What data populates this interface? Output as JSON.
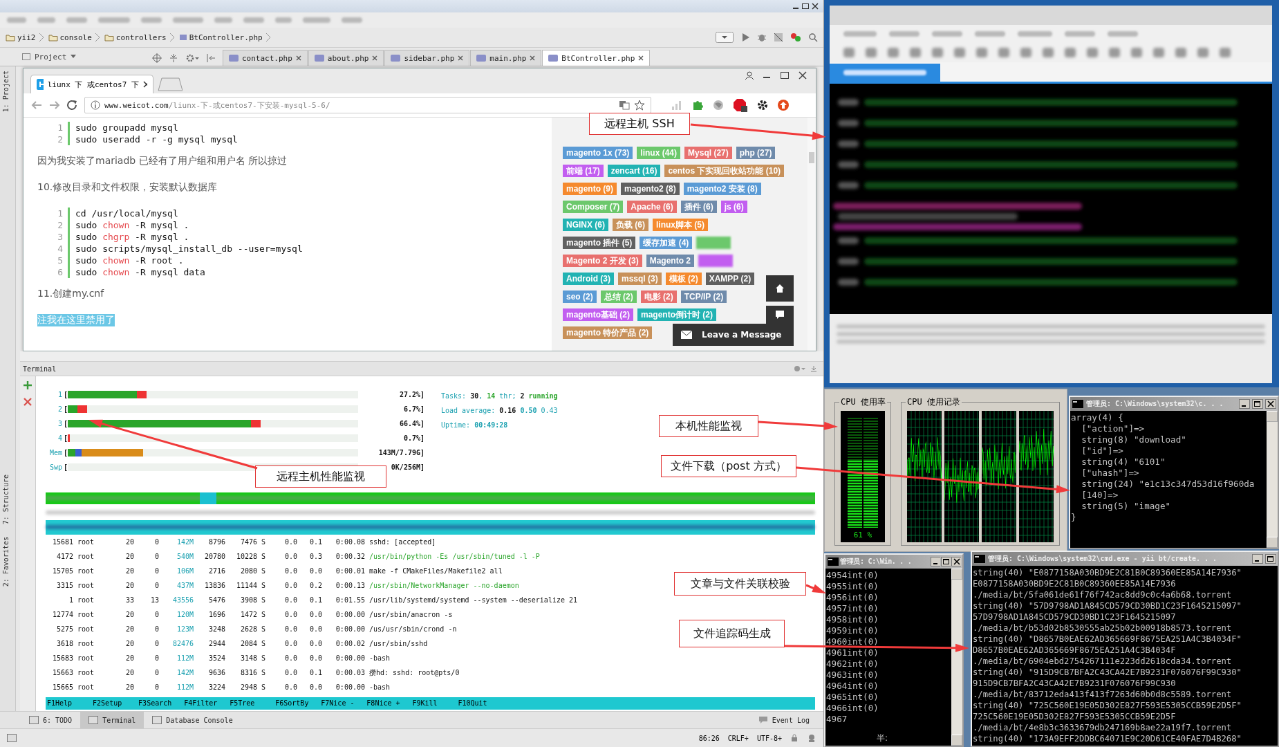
{
  "ide": {
    "breadcrumb": [
      "yii2",
      "console",
      "controllers",
      "BtController.php"
    ],
    "project_tab": "Project",
    "editor_tabs": [
      {
        "label": "contact.php",
        "selected": false
      },
      {
        "label": "about.php",
        "selected": false
      },
      {
        "label": "sidebar.php",
        "selected": false
      },
      {
        "label": "main.php",
        "selected": false
      },
      {
        "label": "BtController.php",
        "selected": true
      }
    ],
    "side_tools": [
      "1: Project",
      "7: Structure",
      "2: Favorites"
    ],
    "browser": {
      "tab_title": "liunx 下 或centos7 下",
      "url_host": "www.weicot.com",
      "url_path": "/liunx-下-或centos7-下安装-mysql-5-6/",
      "content": [
        {
          "kind": "code",
          "lines": [
            {
              "no": "1",
              "parts": [
                {
                  "t": "sudo groupadd mysql",
                  "kind": "plain"
                }
              ]
            },
            {
              "no": "2",
              "parts": [
                {
                  "t": "sudo useradd -r -g mysql mysql",
                  "kind": "plain"
                }
              ]
            }
          ]
        },
        {
          "kind": "para",
          "text": "因为我安装了mariadb 已经有了用户组和用户名 所以掠过",
          "highlighted": false
        },
        {
          "kind": "para",
          "text": "10.修改目录和文件权限，安装默认数据库",
          "highlighted": false
        },
        {
          "kind": "code",
          "lines": [
            {
              "no": "1",
              "parts": [
                {
                  "t": "cd /usr/local/mysql",
                  "kind": "plain"
                }
              ]
            },
            {
              "no": "2",
              "parts": [
                {
                  "t": "sudo ",
                  "kind": "plain"
                },
                {
                  "t": "chown",
                  "kind": "keyword"
                },
                {
                  "t": " -R mysql .",
                  "kind": "plain"
                }
              ]
            },
            {
              "no": "3",
              "parts": [
                {
                  "t": "sudo ",
                  "kind": "plain"
                },
                {
                  "t": "chgrp",
                  "kind": "keyword"
                },
                {
                  "t": " -R mysql .",
                  "kind": "plain"
                }
              ]
            },
            {
              "no": "4",
              "parts": [
                {
                  "t": "sudo scripts/mysql_install_db --user=mysql",
                  "kind": "plain"
                }
              ]
            },
            {
              "no": "5",
              "parts": [
                {
                  "t": "sudo ",
                  "kind": "plain"
                },
                {
                  "t": "chown",
                  "kind": "keyword"
                },
                {
                  "t": " -R root .",
                  "kind": "plain"
                }
              ]
            },
            {
              "no": "6",
              "parts": [
                {
                  "t": "sudo ",
                  "kind": "plain"
                },
                {
                  "t": "chown",
                  "kind": "keyword"
                },
                {
                  "t": " -R mysql data",
                  "kind": "plain"
                }
              ]
            }
          ]
        },
        {
          "kind": "para",
          "text": "11.创建my.cnf",
          "highlighted": false
        },
        {
          "kind": "para",
          "text": "注我在这里禁用了",
          "highlighted": true
        }
      ],
      "tag_rows": [
        [
          {
            "kind": "tag",
            "label": "magento 1x (73)",
            "color": "#5b9bd5"
          },
          {
            "kind": "tag",
            "label": "linux (44)",
            "color": "#6cc86c"
          },
          {
            "kind": "tag",
            "label": "Mysql (27)",
            "color": "#e8706e"
          },
          {
            "kind": "tag",
            "label": "php (27)",
            "color": "#6f8bab"
          }
        ],
        [
          {
            "kind": "tag",
            "label": "前端 (17)",
            "color": "#c25ef0"
          },
          {
            "kind": "tag",
            "label": "zencart (16)",
            "color": "#22b3b3"
          },
          {
            "kind": "tag",
            "label": "centos 下实现回收站功能 (10)",
            "color": "#c8915a"
          }
        ],
        [
          {
            "kind": "tag",
            "label": "magento (9)",
            "color": "#f58a2e"
          },
          {
            "kind": "tag",
            "label": "magento2 (8)",
            "color": "#606060"
          },
          {
            "kind": "tag",
            "label": "magento2 安装 (8)",
            "color": "#5b9bd5"
          }
        ],
        [
          {
            "kind": "tag",
            "label": "Composer (7)",
            "color": "#6cc86c"
          },
          {
            "kind": "tag",
            "label": "Apache (6)",
            "color": "#e8706e"
          },
          {
            "kind": "tag",
            "label": "插件 (6)",
            "color": "#6f8bab"
          },
          {
            "kind": "tag",
            "label": "js (6)",
            "color": "#c25ef0"
          }
        ],
        [
          {
            "kind": "tag",
            "label": "NGINX (6)",
            "color": "#22b3b3"
          },
          {
            "kind": "tag",
            "label": "负载 (6)",
            "color": "#c8915a"
          },
          {
            "kind": "tag",
            "label": "linux脚本 (5)",
            "color": "#f58a2e"
          }
        ],
        [
          {
            "kind": "tag",
            "label": "magento 插件 (5)",
            "color": "#606060"
          },
          {
            "kind": "tag",
            "label": "缓存加速 (4)",
            "color": "#5b9bd5"
          },
          {
            "kind": "blurred",
            "color": "#6cc86c"
          }
        ],
        [
          {
            "kind": "tag",
            "label": "Magento 2 开发 (3)",
            "color": "#e8706e"
          },
          {
            "kind": "tag",
            "label": "Magento 2",
            "color": "#6f8bab"
          },
          {
            "kind": "blurred",
            "color": "#c25ef0"
          }
        ],
        [
          {
            "kind": "tag",
            "label": "Android (3)",
            "color": "#22b3b3"
          },
          {
            "kind": "tag",
            "label": "mssql (3)",
            "color": "#c8915a"
          },
          {
            "kind": "tag",
            "label": "模板 (2)",
            "color": "#f58a2e"
          },
          {
            "kind": "tag",
            "label": "XAMPP (2)",
            "color": "#606060"
          }
        ],
        [
          {
            "kind": "tag",
            "label": "seo (2)",
            "color": "#5b9bd5"
          },
          {
            "kind": "tag",
            "label": "总结 (2)",
            "color": "#6cc86c"
          },
          {
            "kind": "tag",
            "label": "电影 (2)",
            "color": "#e8706e"
          },
          {
            "kind": "tag",
            "label": "TCP/IP (2)",
            "color": "#6f8bab"
          }
        ],
        [
          {
            "kind": "tag",
            "label": "magento基础 (2)",
            "color": "#c25ef0"
          },
          {
            "kind": "tag",
            "label": "magento倒计时 (2)",
            "color": "#22b3b3"
          }
        ],
        [
          {
            "kind": "tag",
            "label": "magento 特价产品 (2)",
            "color": "#c8915a"
          }
        ]
      ],
      "leave_message": "Leave a Message"
    },
    "terminal": {
      "title": "Terminal",
      "meters": [
        {
          "label": "1",
          "kind": "cpu",
          "bracket": "[",
          "level": 0.272,
          "reading": "27.2%]"
        },
        {
          "label": "2",
          "kind": "cpu",
          "bracket": "[",
          "level": 0.067,
          "reading": "6.7%]"
        },
        {
          "label": "3",
          "kind": "cpu",
          "bracket": "[",
          "level": 0.664,
          "reading": "66.4%]"
        },
        {
          "label": "4",
          "kind": "cpu",
          "bracket": "[",
          "level": 0.007,
          "reading": "0.7%]"
        },
        {
          "label": "Mem",
          "kind": "mem",
          "bracket": "[",
          "level": 0.26,
          "reading": "143M/7.79G]"
        },
        {
          "label": "Swp",
          "bracket": "[",
          "reading": "0K/256M]"
        }
      ],
      "summary": [
        [
          {
            "t": "Tasks: ",
            "kind": "label"
          },
          {
            "t": "30",
            "kind": "value"
          },
          {
            "t": ", ",
            "kind": "label"
          },
          {
            "t": "14",
            "kind": "accent"
          },
          {
            "t": " thr; ",
            "kind": "label"
          },
          {
            "t": "2",
            "kind": "value"
          },
          {
            "t": " running",
            "kind": "accent"
          }
        ],
        [
          {
            "t": "Load average: ",
            "kind": "label"
          },
          {
            "t": "0.16",
            "kind": "value"
          },
          {
            "t": " 0.50",
            "kind": "strong"
          },
          {
            "t": " 0.43",
            "kind": "label"
          }
        ],
        [
          {
            "t": "Uptime: ",
            "kind": "label"
          },
          {
            "t": "00:49:28",
            "kind": "strong"
          }
        ]
      ],
      "processes": [
        {
          "kind": "blurred"
        },
        {
          "kind": "blurred_selected"
        },
        {
          "kind": "row",
          "pid": "15681",
          "user": "root",
          "pri": "20",
          "ni": "0",
          "virt": "142M",
          "res": "8796",
          "shr": "7476",
          "s": "S",
          "cpu": "0.0",
          "mem": "0.1",
          "time": "0:00.08",
          "command": "sshd: [accepted]",
          "highlight": false
        },
        {
          "kind": "row",
          "pid": "4172",
          "user": "root",
          "pri": "20",
          "ni": "0",
          "virt": "540M",
          "res": "20780",
          "shr": "10228",
          "s": "S",
          "cpu": "0.0",
          "mem": "0.3",
          "time": "0:00.32",
          "command": "/usr/bin/python -Es /usr/sbin/tuned -l -P",
          "highlight": true
        },
        {
          "kind": "row",
          "pid": "15705",
          "user": "root",
          "pri": "20",
          "ni": "0",
          "virt": "106M",
          "res": "2716",
          "shr": "2080",
          "s": "S",
          "cpu": "0.0",
          "mem": "0.0",
          "time": "0:00.01",
          "command": "make -f CMakeFiles/Makefile2 all",
          "highlight": false
        },
        {
          "kind": "row",
          "pid": "3315",
          "user": "root",
          "pri": "20",
          "ni": "0",
          "virt": "437M",
          "res": "13836",
          "shr": "11144",
          "s": "S",
          "cpu": "0.0",
          "mem": "0.2",
          "time": "0:00.13",
          "command": "/usr/sbin/NetworkManager --no-daemon",
          "highlight": true
        },
        {
          "kind": "row",
          "pid": "1",
          "user": "root",
          "pri": "33",
          "ni": "13",
          "virt": "43556",
          "res": "5476",
          "shr": "3908",
          "s": "S",
          "cpu": "0.0",
          "mem": "0.1",
          "time": "0:01.55",
          "command": "/usr/lib/systemd/systemd --system --deserialize 21",
          "highlight": false
        },
        {
          "kind": "row",
          "pid": "12774",
          "user": "root",
          "pri": "20",
          "ni": "0",
          "virt": "120M",
          "res": "1696",
          "shr": "1472",
          "s": "S",
          "cpu": "0.0",
          "mem": "0.0",
          "time": "0:00.00",
          "command": "/usr/sbin/anacron -s",
          "highlight": false
        },
        {
          "kind": "row",
          "pid": "5275",
          "user": "root",
          "pri": "20",
          "ni": "0",
          "virt": "123M",
          "res": "3248",
          "shr": "2628",
          "s": "S",
          "cpu": "0.0",
          "mem": "0.0",
          "time": "0:00.00",
          "command": "/us/usr/sbin/crond -n",
          "highlight": false
        },
        {
          "kind": "row",
          "pid": "3618",
          "user": "root",
          "pri": "20",
          "ni": "0",
          "virt": "82476",
          "res": "2944",
          "shr": "2084",
          "s": "S",
          "cpu": "0.0",
          "mem": "0.0",
          "time": "0:00.02",
          "command": "/usr/sbin/sshd",
          "highlight": false
        },
        {
          "kind": "row",
          "pid": "15683",
          "user": "root",
          "pri": "20",
          "ni": "0",
          "virt": "112M",
          "res": "3524",
          "shr": "3148",
          "s": "S",
          "cpu": "0.0",
          "mem": "0.0",
          "time": "0:00.00",
          "command": "-bash",
          "highlight": false
        },
        {
          "kind": "row",
          "pid": "15663",
          "user": "root",
          "pri": "20",
          "ni": "0",
          "virt": "142M",
          "res": "9636",
          "shr": "8316",
          "s": "S",
          "cpu": "0.0",
          "mem": "0.1",
          "time": "0:00.03",
          "command": "攒hd: sshd: root@pts/0",
          "highlight": false
        },
        {
          "kind": "row",
          "pid": "15665",
          "user": "root",
          "pri": "20",
          "ni": "0",
          "virt": "112M",
          "res": "3224",
          "shr": "2948",
          "s": "S",
          "cpu": "0.0",
          "mem": "0.0",
          "time": "0:00.00",
          "command": "-bash",
          "highlight": false
        }
      ],
      "function_keys": [
        {
          "key": "F1",
          "label": "Help"
        },
        {
          "key": "F2",
          "label": "Setup"
        },
        {
          "key": "F3",
          "label": "Search"
        },
        {
          "key": "F4",
          "label": "Filter"
        },
        {
          "key": "F5",
          "label": "Tree"
        },
        {
          "key": "F6",
          "label": "SortBy"
        },
        {
          "key": "F7",
          "label": "Nice -"
        },
        {
          "key": "F8",
          "label": "Nice +"
        },
        {
          "key": "F9",
          "label": "Kill"
        },
        {
          "key": "F10",
          "label": "Quit"
        }
      ]
    },
    "tool_tabs": [
      {
        "label": "6: TODO",
        "selected": false
      },
      {
        "label": "Terminal",
        "selected": true
      },
      {
        "label": "Database Console",
        "selected": false
      }
    ],
    "event_log": "Event Log",
    "status_bar": [
      "86:26",
      "CRLF÷",
      "UTF-8÷"
    ]
  },
  "cpu_monitor": {
    "usage_title": "CPU 使用率",
    "usage_reading": "61 %",
    "level": 0.61,
    "history_title": "CPU 使用记录"
  },
  "cmd_dump": {
    "title": "管理员: C:\\Windows\\system32\\c. . .",
    "lines": [
      "array(4) {",
      "  [\"action\"]=>",
      "  string(8) \"download\"",
      "  [\"id\"]=>",
      "  string(4) \"6101\"",
      "  [\"uhash\"]=>",
      "  string(24) \"e1c13c347d53d16f960da",
      "  [140]=>",
      "  string(5) \"image\"",
      "}"
    ]
  },
  "cmd_counter": {
    "title": "管理员: C:\\Win. . .",
    "lines": [
      "4954int(0)",
      "4955int(0)",
      "4956int(0)",
      "4957int(0)",
      "4958int(0)",
      "4959int(0)",
      "4960int(0)",
      "4961int(0)",
      "4962int(0)",
      "4963int(0)",
      "4964int(0)",
      "4965int(0)",
      "4966int(0)",
      "4967"
    ],
    "ime_status": "半:"
  },
  "cmd_hashes": {
    "title": "管理员: C:\\Windows\\system32\\cmd.exe - yii  bt/create. . .",
    "lines": [
      "string(40) \"E0877158A030BD9E2C81B0C89360EE85A14E7936\"",
      "E0877158A030BD9E2C81B0C89360EE85A14E7936",
      "./media/bt/5fa061de61f76f742ac8dd9c0c4a6b68.torrent",
      "string(40) \"57D9798AD1A845CD579CD30BD1C23F1645215097\"",
      "57D9798AD1A845CD579CD30BD1C23F1645215097",
      "./media/bt/b53d02b8530555ab25b02b00918b8573.torrent",
      "string(40) \"D8657B0EAE62AD365669F8675EA251A4C3B4034F\"",
      "D8657B0EAE62AD365669F8675EA251A4C3B4034F",
      "./media/bt/6904ebd2754267111e223dd2618cda34.torrent",
      "string(40) \"915D9CB7BFA2C43CA42E7B9231F076076F99C930\"",
      "915D9CB7BFA2C43CA42E7B9231F076076F99C930",
      "./media/bt/83712eda413f413f7263d60b0d8c5589.torrent",
      "string(40) \"725C560E19E05D302E827F593E5305CCB59E2D5F\"",
      "725C560E19E05D302E827F593E5305CCB59E2D5F",
      "./media/bt/4e8b3c3633679db247169b8ae22a19f7.torrent",
      "string(40) \"173A9EFF2DDBC64071E9C20D61CE40FAE7D4B268\""
    ]
  },
  "annotations": [
    "远程主机 SSH",
    "远程主机性能监视",
    "本机性能监视",
    "文件下载（post 方式）",
    "文章与文件关联校验",
    "文件追踪码生成"
  ]
}
